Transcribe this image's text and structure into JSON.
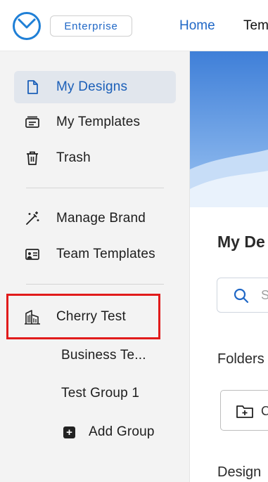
{
  "header": {
    "badge_label": "Enterprise",
    "nav": {
      "home": "Home",
      "templates": "Tem"
    }
  },
  "sidebar": {
    "items": [
      {
        "label": "My Designs",
        "icon": "document-icon",
        "active": true
      },
      {
        "label": "My Templates",
        "icon": "templates-icon"
      },
      {
        "label": "Trash",
        "icon": "trash-icon"
      },
      {
        "label": "Manage Brand",
        "icon": "magic-wand-icon"
      },
      {
        "label": "Team Templates",
        "icon": "team-templates-icon"
      },
      {
        "label": "Cherry Test",
        "icon": "building-icon"
      }
    ],
    "sub_items": [
      "Business Te...",
      "Test Group 1"
    ],
    "add_group_label": "Add Group"
  },
  "main": {
    "title": "My De",
    "search_placeholder": "S",
    "folders_heading": "Folders",
    "create_folder_label": "C",
    "designs_heading": "Design"
  },
  "colors": {
    "accent": "#1f67c6",
    "active_bg": "#e1e6ed",
    "highlight": "#e11b1b",
    "sidebar_bg": "#f3f3f3"
  }
}
